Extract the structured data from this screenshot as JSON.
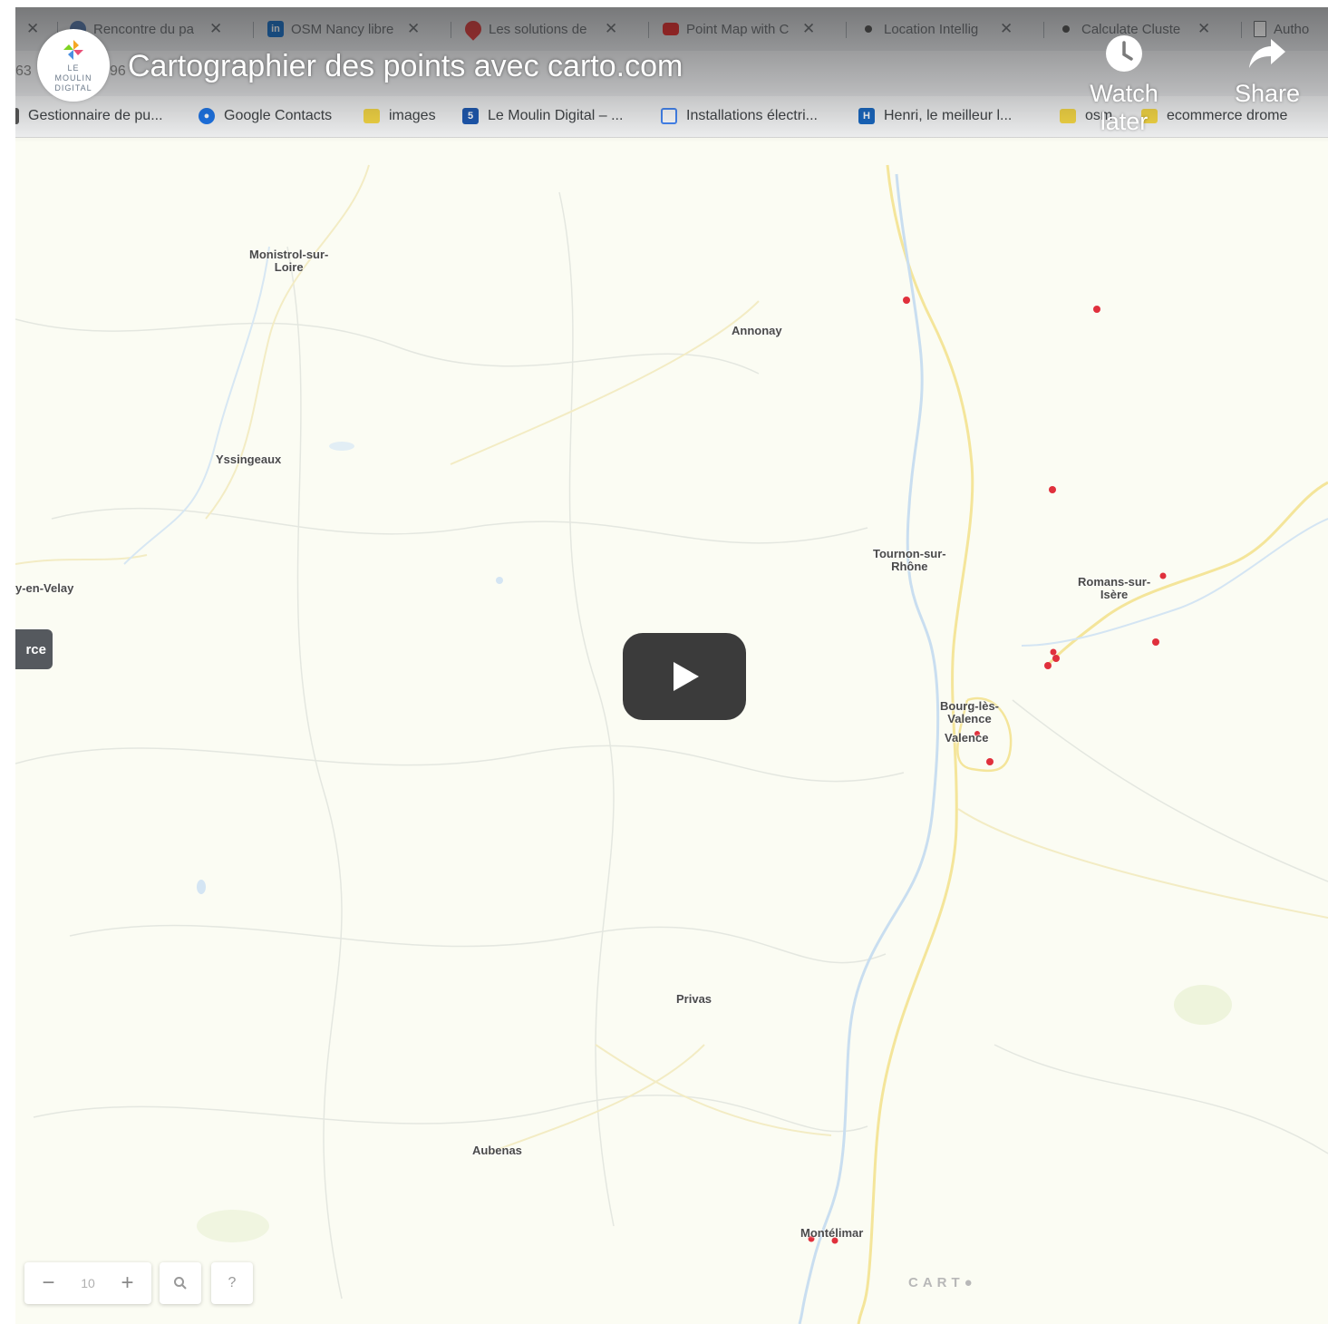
{
  "browser": {
    "tabs": [
      {
        "title": "",
        "favicon": "close-icon",
        "color": "#5f6368"
      },
      {
        "title": "Rencontre du pa",
        "favicon": "globe-icon",
        "color": "#4285f4"
      },
      {
        "title": "OSM Nancy libre",
        "favicon": "linkedin-icon",
        "color": "#0a66c2"
      },
      {
        "title": "Les solutions de",
        "favicon": "pin-icon",
        "color": "#d32f2f"
      },
      {
        "title": "Point Map with C",
        "favicon": "youtube-icon",
        "color": "#ff0000"
      },
      {
        "title": "Location Intellig",
        "favicon": "dot-icon",
        "color": "#444444"
      },
      {
        "title": "Calculate Cluste",
        "favicon": "dot-icon",
        "color": "#444444"
      },
      {
        "title": "Autho",
        "favicon": "document-icon",
        "color": "#5f6368"
      }
    ],
    "url_fragment": "63",
    "url_fragment2": "96",
    "bookmarks": [
      {
        "label": "Gestionnaire de pu...",
        "icon": "page-icon",
        "color": "#555555"
      },
      {
        "label": "Google Contacts",
        "icon": "contacts-icon",
        "color": "#1a73e8"
      },
      {
        "label": "images",
        "icon": "folder-icon",
        "color": "#f5d742"
      },
      {
        "label": "Le Moulin Digital – ...",
        "icon": "site-icon",
        "color": "#1a56b0"
      },
      {
        "label": "Installations électri...",
        "icon": "calendar-icon",
        "color": "#4285f4"
      },
      {
        "label": "Henri, le meilleur l...",
        "icon": "site-icon",
        "color": "#1565c0"
      },
      {
        "label": "osm",
        "icon": "folder-icon",
        "color": "#f5d742"
      },
      {
        "label": "ecommerce drome",
        "icon": "folder-icon",
        "color": "#f5d742"
      }
    ]
  },
  "video": {
    "channel_logo_text": [
      "LE",
      "MOULIN",
      "DIGITAL"
    ],
    "title": "Cartographier des points avec carto.com",
    "watch_later_label": "Watch later",
    "share_label": "Share"
  },
  "map": {
    "cities": [
      {
        "name": "Monistrol-sur-\nLoire"
      },
      {
        "name": "Annonay"
      },
      {
        "name": "Yssingeaux"
      },
      {
        "name": "Tournon-sur-\nRhône"
      },
      {
        "name": "Romans-sur-\nIsère"
      },
      {
        "name": "y-en-Velay"
      },
      {
        "name": "Bourg-lès-\nValence"
      },
      {
        "name": "Valence"
      },
      {
        "name": "Privas"
      },
      {
        "name": "Aubenas"
      },
      {
        "name": "Montélimar"
      }
    ],
    "source_button_label": "rce",
    "zoom_level": "10",
    "zoom_out": "−",
    "zoom_in": "+",
    "help_label": "?",
    "carto_logo": "CART●",
    "point_color": "#e0303c",
    "points_count_visible": 12
  }
}
